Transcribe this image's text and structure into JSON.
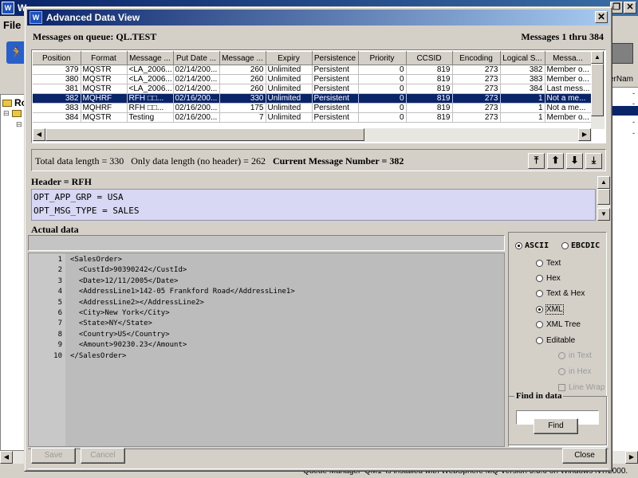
{
  "background": {
    "app_title_letter": "W",
    "title_fragment": "W",
    "menu_file": "File",
    "tree_root_label": "Ro",
    "right_column_header": "erNam",
    "status_text": "Queue Manager 'QM1' is installed with WebSphere MQ Version 5.3.0 on Windows NT/2000."
  },
  "dialog": {
    "title": "Advanced Data View",
    "close_glyph": "✕",
    "queue_label": "Messages on queue: QL.TEST",
    "messages_range": "Messages 1 thru 384",
    "table": {
      "columns": [
        "Position",
        "Format",
        "Message ...",
        "Put Date ...",
        "Message ...",
        "Expiry",
        "Persistence",
        "Priority",
        "CCSID",
        "Encoding",
        "Logical S...",
        "Messa..."
      ],
      "rows": [
        {
          "position": "379",
          "format": "MQSTR",
          "msgid": "<LA_2006...",
          "putdate": "02/14/200...",
          "length": "260",
          "expiry": "Unlimited",
          "persistence": "Persistent",
          "priority": "0",
          "ccsid": "819",
          "encoding": "273",
          "logical": "382",
          "message": "Member o..."
        },
        {
          "position": "380",
          "format": "MQSTR",
          "msgid": "<LA_2006...",
          "putdate": "02/14/200...",
          "length": "260",
          "expiry": "Unlimited",
          "persistence": "Persistent",
          "priority": "0",
          "ccsid": "819",
          "encoding": "273",
          "logical": "383",
          "message": "Member o..."
        },
        {
          "position": "381",
          "format": "MQSTR",
          "msgid": "<LA_2006...",
          "putdate": "02/14/200...",
          "length": "260",
          "expiry": "Unlimited",
          "persistence": "Persistent",
          "priority": "0",
          "ccsid": "819",
          "encoding": "273",
          "logical": "384",
          "message": "Last mess..."
        },
        {
          "position": "382",
          "format": "MQHRF",
          "msgid": "RFH □□...",
          "putdate": "02/16/200...",
          "length": "330",
          "expiry": "Unlimited",
          "persistence": "Persistent",
          "priority": "0",
          "ccsid": "819",
          "encoding": "273",
          "logical": "1",
          "message": "Not a me...",
          "selected": true
        },
        {
          "position": "383",
          "format": "MQHRF",
          "msgid": "RFH □□...",
          "putdate": "02/16/200...",
          "length": "175",
          "expiry": "Unlimited",
          "persistence": "Persistent",
          "priority": "0",
          "ccsid": "819",
          "encoding": "273",
          "logical": "1",
          "message": "Not a me..."
        },
        {
          "position": "384",
          "format": "MQSTR",
          "msgid": "Testing",
          "putdate": "02/16/200...",
          "length": "7",
          "expiry": "Unlimited",
          "persistence": "Persistent",
          "priority": "0",
          "ccsid": "819",
          "encoding": "273",
          "logical": "1",
          "message": "Member o..."
        }
      ]
    },
    "info": {
      "total_length": "Total data length = 330",
      "only_data_length": "Only data length (no header) = 262",
      "current_message": "Current Message Number = 382"
    },
    "nav": {
      "first": "⤒",
      "prev": "⬆",
      "next": "⬇",
      "last": "⤓"
    },
    "header_section": {
      "title": "Header = RFH",
      "lines": [
        "OPT_APP_GRP = USA",
        "OPT_MSG_TYPE = SALES"
      ]
    },
    "actual_data": {
      "title": "Actual data",
      "lines": [
        {
          "num": "1",
          "code": "<SalesOrder>"
        },
        {
          "num": "2",
          "code": "  <CustId>90390242</CustId>"
        },
        {
          "num": "3",
          "code": "  <Date>12/11/2005</Date>"
        },
        {
          "num": "4",
          "code": "  <AddressLine1>142-05 Frankford Road</AddressLine1>"
        },
        {
          "num": "5",
          "code": "  <AddressLine2></AddressLine2>"
        },
        {
          "num": "6",
          "code": "  <City>New York</City>"
        },
        {
          "num": "7",
          "code": "  <State>NY</State>"
        },
        {
          "num": "8",
          "code": "  <Country>US</Country>"
        },
        {
          "num": "9",
          "code": "  <Amount>90230.23</Amount>"
        },
        {
          "num": "10",
          "code": "</SalesOrder>"
        }
      ]
    },
    "options": {
      "ascii": "ASCII",
      "ebcdic": "EBCDIC",
      "text": "Text",
      "hex": "Hex",
      "text_hex": "Text & Hex",
      "xml": "XML",
      "xml_tree": "XML Tree",
      "editable": "Editable",
      "in_text": "in Text",
      "in_hex": "in Hex",
      "line_wrap": "Line Wrap"
    },
    "find": {
      "title": "Find in data",
      "input_value": "",
      "button": "Find"
    },
    "footer": {
      "save": "Save",
      "cancel": "Cancel",
      "close": "Close"
    }
  }
}
